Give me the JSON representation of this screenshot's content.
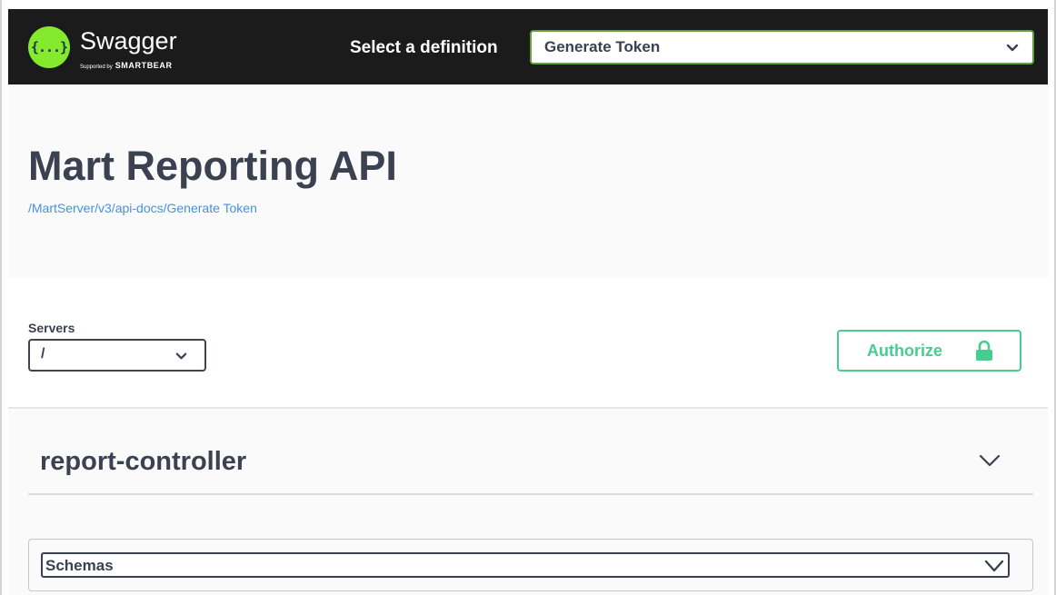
{
  "topbar": {
    "logo_mark": "{...}",
    "logo_name": "Swagger",
    "logo_sub_small": "Supported by",
    "logo_sub": "SMARTBEAR",
    "select_label": "Select a definition",
    "definition_value": "Generate Token"
  },
  "info": {
    "title": "Mart Reporting API",
    "url": "/MartServer/v3/api-docs/Generate Token"
  },
  "servers": {
    "label": "Servers",
    "selected": "/"
  },
  "authorize": {
    "label": "Authorize"
  },
  "tag": {
    "name": "report-controller"
  },
  "schemas": {
    "label": "Schemas"
  },
  "colors": {
    "topbar_bg": "#1b1b1b",
    "logo_green": "#85ea2d",
    "authorize_green": "#49cc90",
    "link_blue": "#4990e2",
    "text": "#3b4151"
  },
  "icons": [
    "swagger-logo-icon",
    "chevron-down-icon",
    "lock-icon"
  ]
}
